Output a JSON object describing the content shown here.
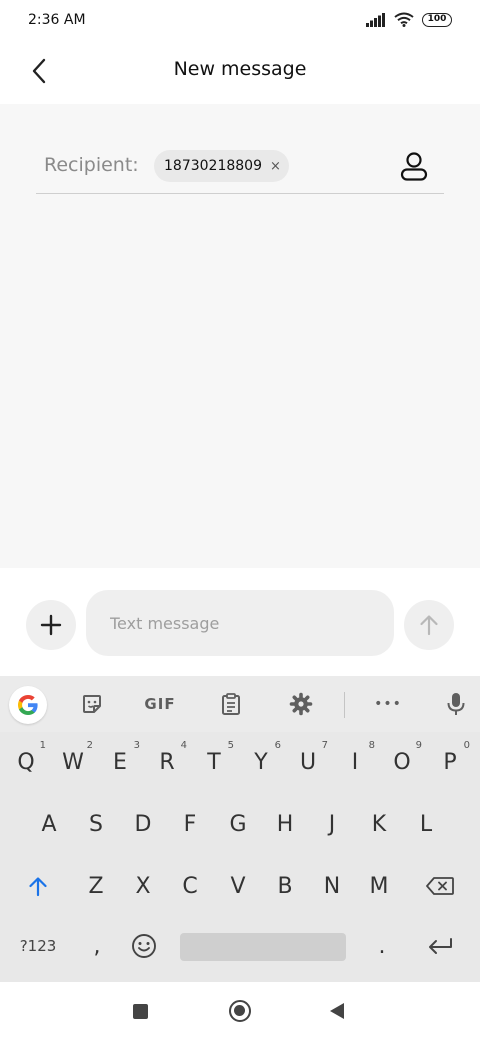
{
  "status_bar": {
    "time": "2:36 AM",
    "battery": "100"
  },
  "header": {
    "title": "New message"
  },
  "recipient": {
    "label": "Recipient:",
    "chips": [
      "18730218809"
    ],
    "chip_close": "×"
  },
  "compose": {
    "placeholder": "Text message"
  },
  "keyboard": {
    "toolbar": {
      "gif_label": "GIF",
      "more_label": "•••"
    },
    "row1": [
      {
        "key": "Q",
        "hint": "1"
      },
      {
        "key": "W",
        "hint": "2"
      },
      {
        "key": "E",
        "hint": "3"
      },
      {
        "key": "R",
        "hint": "4"
      },
      {
        "key": "T",
        "hint": "5"
      },
      {
        "key": "Y",
        "hint": "6"
      },
      {
        "key": "U",
        "hint": "7"
      },
      {
        "key": "I",
        "hint": "8"
      },
      {
        "key": "O",
        "hint": "9"
      },
      {
        "key": "P",
        "hint": "0"
      }
    ],
    "row2": [
      "A",
      "S",
      "D",
      "F",
      "G",
      "H",
      "J",
      "K",
      "L"
    ],
    "row3": [
      "Z",
      "X",
      "C",
      "V",
      "B",
      "N",
      "M"
    ],
    "symbols_label": "?123",
    "comma": ",",
    "period": "."
  },
  "colors": {
    "accent_blue": "#1a73e8",
    "main_bg": "#f7f7f7",
    "keyboard_bg": "#e8e8e8"
  }
}
